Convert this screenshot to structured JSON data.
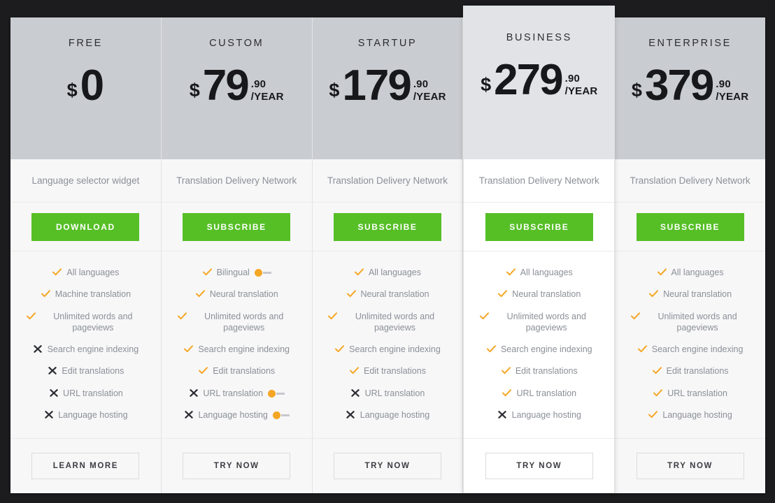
{
  "theme": {
    "page_background": "#1c1c1e",
    "card_background": "#f7f7f8",
    "header_background": "#c9ccd1",
    "featured_header_background": "#e1e3e6",
    "featured_body_background": "#ffffff",
    "primary_button_color": "#56bf26",
    "check_color": "#f5a623",
    "cross_color": "#2b2d32",
    "toggle_knob_color": "#f5a623",
    "toggle_track_color": "#c6c8cc",
    "muted_text_color": "#8b8f96"
  },
  "icons": {
    "check": "check-icon",
    "cross": "cross-icon",
    "toggle": "toggle-switch-icon"
  },
  "feature_rows": [
    "All languages",
    "Machine translation",
    "Unlimited words and pageviews",
    "Search engine indexing",
    "Edit translations",
    "URL translation",
    "Language hosting"
  ],
  "plans": [
    {
      "name": "FREE",
      "featured": false,
      "currency": "$",
      "amount": "0",
      "cents": "",
      "period": "",
      "has_cents": false,
      "subtitle": "Language selector widget",
      "cta_label": "DOWNLOAD",
      "footer_label": "LEARN MORE",
      "features": [
        {
          "label": "All languages",
          "state": "check",
          "toggle": false
        },
        {
          "label": "Machine translation",
          "state": "check",
          "toggle": false
        },
        {
          "label": "Unlimited words and pageviews",
          "state": "check",
          "toggle": false
        },
        {
          "label": "Search engine indexing",
          "state": "cross",
          "toggle": false
        },
        {
          "label": "Edit translations",
          "state": "cross",
          "toggle": false
        },
        {
          "label": "URL translation",
          "state": "cross",
          "toggle": false
        },
        {
          "label": "Language hosting",
          "state": "cross",
          "toggle": false
        }
      ]
    },
    {
      "name": "CUSTOM",
      "featured": false,
      "currency": "$",
      "amount": "79",
      "cents": ".90",
      "period": "/YEAR",
      "has_cents": true,
      "subtitle": "Translation Delivery Network",
      "cta_label": "SUBSCRIBE",
      "footer_label": "TRY NOW",
      "features": [
        {
          "label": "Bilingual",
          "state": "check",
          "toggle": true
        },
        {
          "label": "Neural translation",
          "state": "check",
          "toggle": false
        },
        {
          "label": "Unlimited words and pageviews",
          "state": "check",
          "toggle": false
        },
        {
          "label": "Search engine indexing",
          "state": "check",
          "toggle": false
        },
        {
          "label": "Edit translations",
          "state": "check",
          "toggle": false
        },
        {
          "label": "URL translation",
          "state": "cross",
          "toggle": true
        },
        {
          "label": "Language hosting",
          "state": "cross",
          "toggle": true
        }
      ]
    },
    {
      "name": "STARTUP",
      "featured": false,
      "currency": "$",
      "amount": "179",
      "cents": ".90",
      "period": "/YEAR",
      "has_cents": true,
      "subtitle": "Translation Delivery Network",
      "cta_label": "SUBSCRIBE",
      "footer_label": "TRY NOW",
      "features": [
        {
          "label": "All languages",
          "state": "check",
          "toggle": false
        },
        {
          "label": "Neural translation",
          "state": "check",
          "toggle": false
        },
        {
          "label": "Unlimited words and pageviews",
          "state": "check",
          "toggle": false
        },
        {
          "label": "Search engine indexing",
          "state": "check",
          "toggle": false
        },
        {
          "label": "Edit translations",
          "state": "check",
          "toggle": false
        },
        {
          "label": "URL translation",
          "state": "cross",
          "toggle": false
        },
        {
          "label": "Language hosting",
          "state": "cross",
          "toggle": false
        }
      ]
    },
    {
      "name": "BUSINESS",
      "featured": true,
      "currency": "$",
      "amount": "279",
      "cents": ".90",
      "period": "/YEAR",
      "has_cents": true,
      "subtitle": "Translation Delivery Network",
      "cta_label": "SUBSCRIBE",
      "footer_label": "TRY NOW",
      "features": [
        {
          "label": "All languages",
          "state": "check",
          "toggle": false
        },
        {
          "label": "Neural translation",
          "state": "check",
          "toggle": false
        },
        {
          "label": "Unlimited words and pageviews",
          "state": "check",
          "toggle": false
        },
        {
          "label": "Search engine indexing",
          "state": "check",
          "toggle": false
        },
        {
          "label": "Edit translations",
          "state": "check",
          "toggle": false
        },
        {
          "label": "URL translation",
          "state": "check",
          "toggle": false
        },
        {
          "label": "Language hosting",
          "state": "cross",
          "toggle": false
        }
      ]
    },
    {
      "name": "ENTERPRISE",
      "featured": false,
      "currency": "$",
      "amount": "379",
      "cents": ".90",
      "period": "/YEAR",
      "has_cents": true,
      "subtitle": "Translation Delivery Network",
      "cta_label": "SUBSCRIBE",
      "footer_label": "TRY NOW",
      "features": [
        {
          "label": "All languages",
          "state": "check",
          "toggle": false
        },
        {
          "label": "Neural translation",
          "state": "check",
          "toggle": false
        },
        {
          "label": "Unlimited words and pageviews",
          "state": "check",
          "toggle": false
        },
        {
          "label": "Search engine indexing",
          "state": "check",
          "toggle": false
        },
        {
          "label": "Edit translations",
          "state": "check",
          "toggle": false
        },
        {
          "label": "URL translation",
          "state": "check",
          "toggle": false
        },
        {
          "label": "Language hosting",
          "state": "check",
          "toggle": false
        }
      ]
    }
  ]
}
